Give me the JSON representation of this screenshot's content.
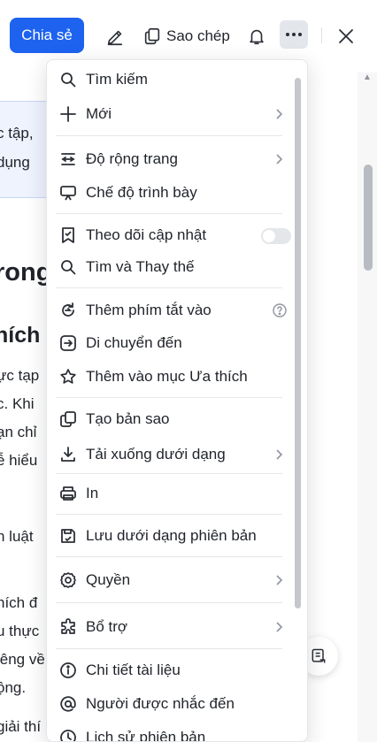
{
  "toolbar": {
    "share_label": "Chia sẻ",
    "copy_label": "Sao chép"
  },
  "document": {
    "callout_lines": [
      "c tập,",
      "dụng"
    ],
    "heading_1": "rong",
    "heading_2": "hích",
    "lines": [
      "ực tạp",
      "c. Khi",
      "ạn chỉ",
      "ễ hiểu",
      "n luật",
      "hích đ",
      "u thực",
      "iêng về",
      "ộng.",
      "giải thí"
    ]
  },
  "menu": {
    "items": [
      {
        "label": "Tìm kiếm",
        "icon": "search-icon"
      },
      {
        "label": "Mới",
        "icon": "plus-icon",
        "submenu": true
      },
      {
        "label": "Độ rộng trang",
        "icon": "page-width-icon",
        "submenu": true
      },
      {
        "label": "Chế độ trình bày",
        "icon": "presentation-icon"
      },
      {
        "label": "Theo dõi cập nhật",
        "icon": "bookmark-bell-icon",
        "toggle": false
      },
      {
        "label": "Tìm và Thay thế",
        "icon": "find-replace-icon"
      },
      {
        "label": "Thêm phím tắt vào",
        "icon": "shortcut-icon",
        "help": true
      },
      {
        "label": "Di chuyển đến",
        "icon": "move-to-icon"
      },
      {
        "label": "Thêm vào mục Ưa thích",
        "icon": "star-icon"
      },
      {
        "label": "Tạo bản sao",
        "icon": "duplicate-icon"
      },
      {
        "label": "Tải xuống dưới dạng",
        "icon": "download-icon",
        "submenu": true
      },
      {
        "label": "In",
        "icon": "print-icon"
      },
      {
        "label": "Lưu dưới dạng phiên bản",
        "icon": "save-version-icon"
      },
      {
        "label": "Quyền",
        "icon": "gear-icon",
        "submenu": true
      },
      {
        "label": "Bổ trợ",
        "icon": "plugin-icon",
        "submenu": true
      },
      {
        "label": "Chi tiết tài liệu",
        "icon": "info-icon"
      },
      {
        "label": "Người được nhắc đến",
        "icon": "at-icon"
      },
      {
        "label": "Lịch sử phiên bản",
        "icon": "history-icon"
      }
    ]
  },
  "colors": {
    "accent": "#1d63f0",
    "text": "#1f2329",
    "icon": "#2b2f36",
    "divider": "#e4e6ea"
  }
}
